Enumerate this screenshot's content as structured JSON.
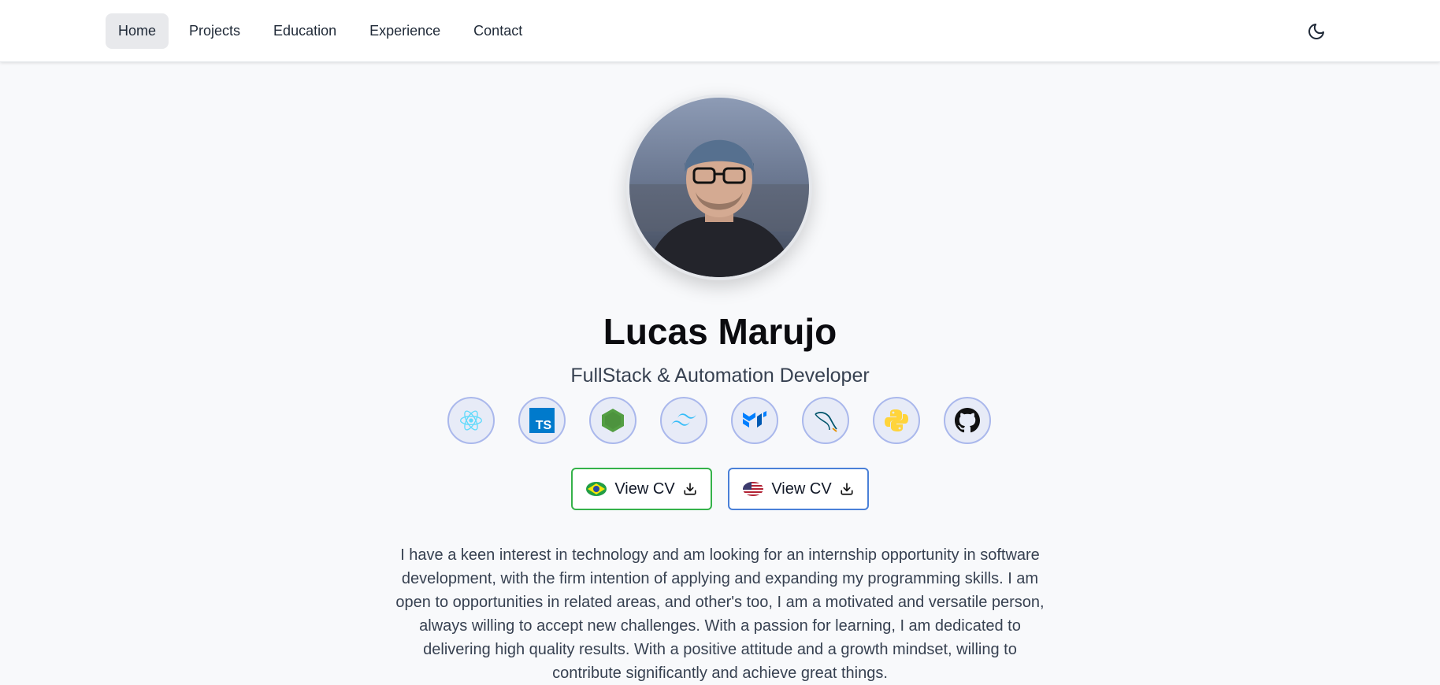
{
  "nav": {
    "items": [
      {
        "label": "Home",
        "active": true
      },
      {
        "label": "Projects",
        "active": false
      },
      {
        "label": "Education",
        "active": false
      },
      {
        "label": "Experience",
        "active": false
      },
      {
        "label": "Contact",
        "active": false
      }
    ],
    "theme_toggle_icon": "moon-icon"
  },
  "profile": {
    "name": "Lucas Marujo",
    "role": "FullStack & Automation Developer"
  },
  "tech_stack": [
    {
      "icon": "react-icon",
      "color": "#61dafb"
    },
    {
      "icon": "typescript-icon",
      "color": "#007acc"
    },
    {
      "icon": "nodejs-icon",
      "color": "#539e43"
    },
    {
      "icon": "tailwind-icon",
      "color": "#38bdf8"
    },
    {
      "icon": "mui-icon",
      "color": "#007fff"
    },
    {
      "icon": "mysql-icon",
      "color": "#00546b"
    },
    {
      "icon": "python-icon",
      "color": "#ffd43b"
    },
    {
      "icon": "github-icon",
      "color": "#111111"
    }
  ],
  "cv_buttons": [
    {
      "label": "View CV",
      "flag": "brazil-flag-icon",
      "border_color": "#35b24a",
      "icon": "download-icon"
    },
    {
      "label": "View CV",
      "flag": "usa-flag-icon",
      "border_color": "#4a80d8",
      "icon": "download-icon"
    }
  ],
  "bio": "I have a keen interest in technology and am looking for an internship opportunity in software development, with the firm intention of applying and expanding my programming skills. I am open to opportunities in related areas, and other's too, I am a motivated and versatile person, always willing to accept new challenges. With a passion for learning, I am dedicated to delivering high quality results. With a positive attitude and a growth mindset, willing to contribute significantly and achieve great things."
}
